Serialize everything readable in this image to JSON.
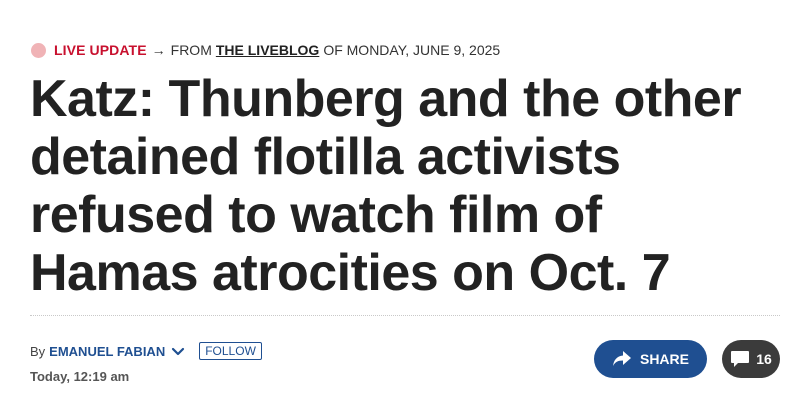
{
  "kicker": {
    "live_label": "LIVE UPDATE",
    "arrow": "→",
    "from_label": "FROM",
    "liveblog_link": "THE LIVEBLOG",
    "date_text": "OF MONDAY, JUNE 9, 2025"
  },
  "headline": "Katz: Thunberg and the other detained flotilla activists refused to watch film of Hamas atrocities on Oct. 7",
  "byline": {
    "by_label": "By",
    "author": "EMANUEL FABIAN",
    "follow_label": "FOLLOW",
    "timestamp": "Today, 12:19 am"
  },
  "actions": {
    "share_label": "SHARE",
    "comment_count": "16"
  },
  "colors": {
    "brand_blue": "#1f4f91",
    "live_red": "#c8102e",
    "live_dot": "#f0b3b6",
    "dark_button": "#3b3b3b"
  },
  "icons": {
    "live": "live-dot-icon",
    "chevron": "chevron-down-icon",
    "share": "share-arrow-icon",
    "comment": "comment-bubble-icon"
  }
}
